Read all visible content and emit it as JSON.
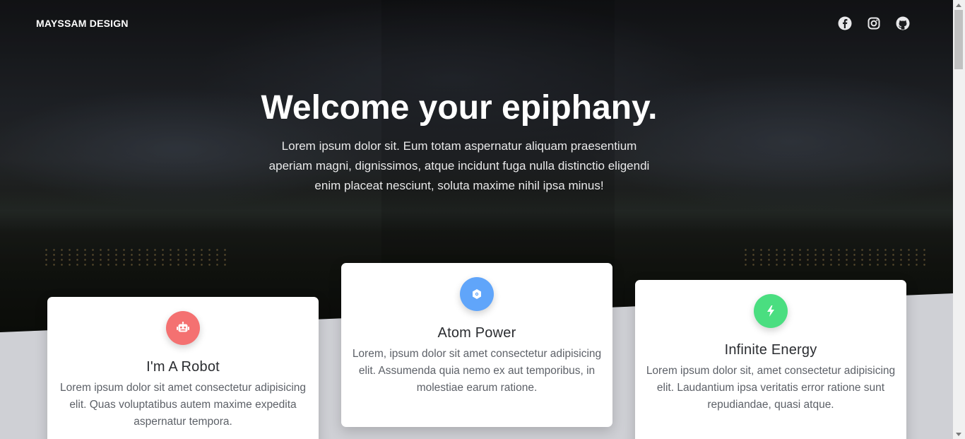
{
  "header": {
    "brand": "MAYSSAM DESIGN",
    "social": [
      {
        "icon": "facebook-icon"
      },
      {
        "icon": "instagram-icon"
      },
      {
        "icon": "github-icon"
      }
    ]
  },
  "hero": {
    "title": "Welcome your epiphany.",
    "subtitle": "Lorem ipsum dolor sit. Eum totam aspernatur aliquam praesentium aperiam magni, dignissimos, atque incidunt fuga nulla distinctio eligendi enim placeat nesciunt, soluta maxime nihil ipsa minus!"
  },
  "cards": [
    {
      "title": "I'm A Robot",
      "text": "Lorem ipsum dolor sit amet consectetur adipisicing elit. Quas voluptatibus autem maxime expedita aspernatur tempora.",
      "icon": "robot-icon",
      "color": "#f47171"
    },
    {
      "title": "Atom Power",
      "text": "Lorem, ipsum dolor sit amet consectetur adipisicing elit. Assumenda quia nemo ex aut temporibus, in molestiae earum ratione.",
      "icon": "atom-icon",
      "color": "#60a5fa"
    },
    {
      "title": "Infinite Energy",
      "text": "Lorem ipsum dolor sit, amet consectetur adipisicing elit. Laudantium ipsa veritatis error ratione sunt repudiandae, quasi atque.",
      "icon": "bolt-icon",
      "color": "#4ade80"
    }
  ],
  "colors": {
    "page_background": "#cfd0d5",
    "hero_text": "#ffffff"
  }
}
